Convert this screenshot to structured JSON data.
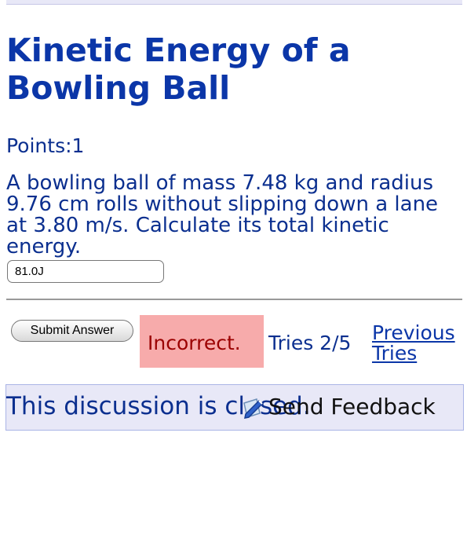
{
  "problem": {
    "title": "Kinetic Energy of a Bowling Ball",
    "points": "Points:1",
    "question": "A bowling ball of mass 7.48 kg and radius 9.76 cm rolls without slipping down a lane at 3.80 m/s. Calculate its total kinetic energy.",
    "answer_value": "81.0J"
  },
  "actions": {
    "submit_label": "Submit Answer"
  },
  "feedback": {
    "status": "Incorrect.",
    "tries": "Tries 2/5",
    "previous_tries": "Previous Tries"
  },
  "discussion": {
    "text": "This discussion is closed.",
    "send_feedback": "Send Feedback",
    "send_icon": "pencil-paper-icon"
  },
  "colors": {
    "title": "#0b36a8",
    "text": "#0b2f8f",
    "incorrect_bg": "#f7abab",
    "incorrect_text": "#9b0000",
    "discussion_bg": "#e8e8f7"
  }
}
